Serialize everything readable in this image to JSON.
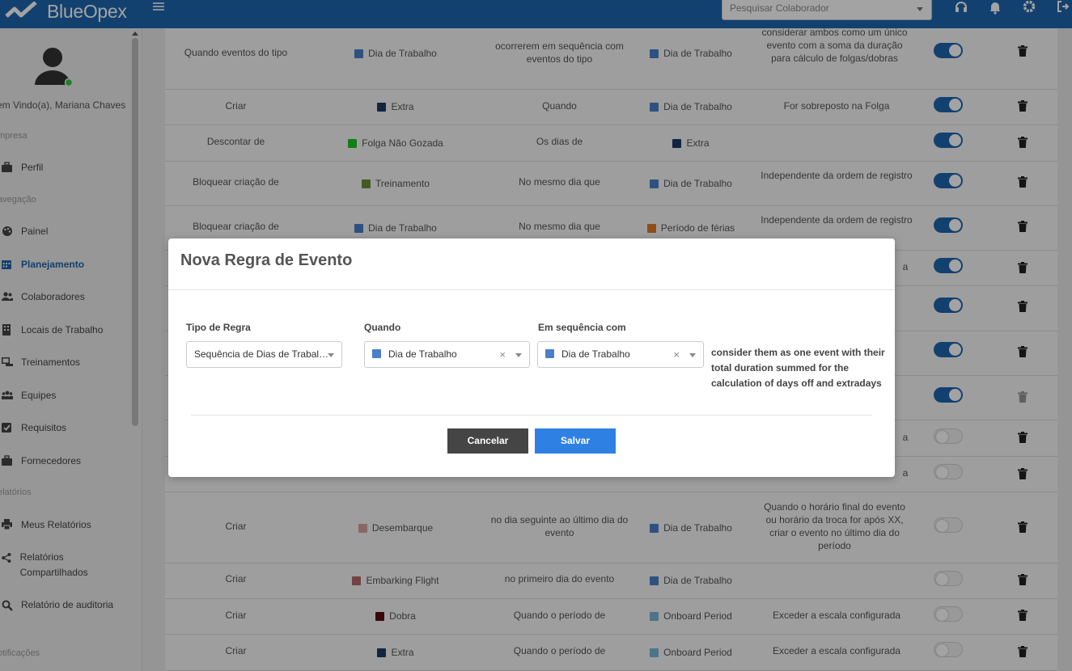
{
  "app": {
    "brand": "BlueOpex"
  },
  "topbar": {
    "search_placeholder": "Pesquisar Colaborador",
    "icons": [
      "headset-icon",
      "bell-icon",
      "gear-icon",
      "logout-icon"
    ]
  },
  "sidebar": {
    "welcome": "em Vindo(a), Mariana Chaves",
    "sections": {
      "empresa": "mpresa",
      "navegacao": "avegação",
      "relatorios": "elatórios",
      "notificacoes": "otificações"
    },
    "items": [
      {
        "label": "Perfil",
        "icon": "briefcase-icon"
      },
      {
        "label": "Painel",
        "icon": "palette-icon"
      },
      {
        "label": "Planejamento",
        "icon": "calendar-icon",
        "active": true
      },
      {
        "label": "Colaboradores",
        "icon": "users-icon"
      },
      {
        "label": "Locais de Trabalho",
        "icon": "building-icon"
      },
      {
        "label": "Treinamentos",
        "icon": "chalkboard-icon"
      },
      {
        "label": "Equipes",
        "icon": "team-icon"
      },
      {
        "label": "Requisitos",
        "icon": "checkbox-icon"
      },
      {
        "label": "Fornecedores",
        "icon": "briefcase-icon"
      },
      {
        "label": "Meus Relatórios",
        "icon": "printer-icon"
      },
      {
        "label": "Relatórios Compartilhados",
        "icon": "share-icon"
      },
      {
        "label": "Relatório de auditoria",
        "icon": "search-doc-icon"
      }
    ]
  },
  "colors": {
    "dia_de_trabalho": "#4a7fcb",
    "extra": "#1f3a66",
    "folga_nao_gozada": "#22c422",
    "treinamento": "#6b8e3a",
    "periodo_ferias": "#e07a22",
    "desembarque": "#d9a0a0",
    "embarking_flight": "#b56a6a",
    "dobra": "#5a0f0f",
    "onboard_period": "#7ab6d8"
  },
  "rules": [
    {
      "c1": "Quando eventos do tipo",
      "c2": {
        "label": "Dia de Trabalho",
        "color": "#4a7fcb"
      },
      "c3": "ocorrerem em sequência com eventos do tipo",
      "c4": {
        "label": "Dia de Trabalho",
        "color": "#4a7fcb"
      },
      "c5": "considerar ambos como um único evento com a soma da duração para cálculo de folgas/dobras",
      "enabled": true,
      "trash_disabled": false
    },
    {
      "c1": "Criar",
      "c2": {
        "label": "Extra",
        "color": "#1f3a66"
      },
      "c3": "Quando",
      "c4": {
        "label": "Dia de Trabalho",
        "color": "#4a7fcb"
      },
      "c5": "For sobreposto na Folga",
      "enabled": true,
      "trash_disabled": false
    },
    {
      "c1": "Descontar de",
      "c2": {
        "label": "Folga Não Gozada",
        "color": "#22c422"
      },
      "c3": "Os dias de",
      "c4": {
        "label": "Extra",
        "color": "#1f3a66"
      },
      "c5": "",
      "enabled": true,
      "trash_disabled": false
    },
    {
      "c1": "Bloquear criação de",
      "c2": {
        "label": "Treinamento",
        "color": "#6b8e3a"
      },
      "c3": "No mesmo dia que",
      "c4": {
        "label": "Dia de Trabalho",
        "color": "#4a7fcb"
      },
      "c5": "Independente da ordem de registro",
      "enabled": true,
      "trash_disabled": false
    },
    {
      "c1": "Bloquear criação de",
      "c2": {
        "label": "Dia de Trabalho",
        "color": "#4a7fcb"
      },
      "c3": "No mesmo dia que",
      "c4": {
        "label": "Período de férias",
        "color": "#e07a22"
      },
      "c5": "Independente da ordem de registro",
      "enabled": true,
      "trash_disabled": false
    },
    {
      "c1": "",
      "c2": {
        "label": "",
        "color": ""
      },
      "c3": "",
      "c4": {
        "label": "",
        "color": ""
      },
      "c5": "a",
      "enabled": true,
      "trash_disabled": false
    },
    {
      "c1": "",
      "c2": {
        "label": "",
        "color": ""
      },
      "c3": "",
      "c4": {
        "label": "",
        "color": ""
      },
      "c5": "",
      "enabled": true,
      "trash_disabled": false
    },
    {
      "c1": "",
      "c2": {
        "label": "",
        "color": ""
      },
      "c3": "",
      "c4": {
        "label": "",
        "color": ""
      },
      "c5": "",
      "enabled": true,
      "trash_disabled": false
    },
    {
      "c1": "",
      "c2": {
        "label": "",
        "color": ""
      },
      "c3": "",
      "c4": {
        "label": "",
        "color": ""
      },
      "c5": "",
      "enabled": true,
      "trash_disabled": true
    },
    {
      "c1": "",
      "c2": {
        "label": "",
        "color": ""
      },
      "c3": "",
      "c4": {
        "label": "",
        "color": ""
      },
      "c5": "a",
      "enabled": false,
      "trash_disabled": false
    },
    {
      "c1": "",
      "c2": {
        "label": "",
        "color": ""
      },
      "c3": "",
      "c4": {
        "label": "",
        "color": ""
      },
      "c5": "a",
      "enabled": false,
      "trash_disabled": false
    },
    {
      "c1": "Criar",
      "c2": {
        "label": "Desembarque",
        "color": "#d9a0a0"
      },
      "c3": "no dia seguinte ao último dia do evento",
      "c4": {
        "label": "Dia de Trabalho",
        "color": "#4a7fcb"
      },
      "c5": "Quando o horário final do evento ou horário da troca for após XX, criar o evento no último dia do período",
      "enabled": false,
      "trash_disabled": false
    },
    {
      "c1": "Criar",
      "c2": {
        "label": "Embarking Flight",
        "color": "#b56a6a"
      },
      "c3": "no primeiro dia do evento",
      "c4": {
        "label": "Dia de Trabalho",
        "color": "#4a7fcb"
      },
      "c5": "",
      "enabled": false,
      "trash_disabled": false
    },
    {
      "c1": "Criar",
      "c2": {
        "label": "Dobra",
        "color": "#5a0f0f"
      },
      "c3": "Quando o período de",
      "c4": {
        "label": "Onboard Period",
        "color": "#7ab6d8"
      },
      "c5": "Exceder a escala configurada",
      "enabled": false,
      "trash_disabled": false
    },
    {
      "c1": "Criar",
      "c2": {
        "label": "Extra",
        "color": "#1f3a66"
      },
      "c3": "Quando o período de",
      "c4": {
        "label": "Onboard Period",
        "color": "#7ab6d8"
      },
      "c5": "Exceder a escala configurada",
      "enabled": false,
      "trash_disabled": false
    }
  ],
  "modal": {
    "title": "Nova Regra de Evento",
    "fields": {
      "tipo_label": "Tipo de Regra",
      "tipo_value": "Sequência de Dias de Trabal…",
      "quando_label": "Quando",
      "quando_value": "Dia de Trabalho",
      "quando_color": "#4a7fcb",
      "sequencia_label": "Em sequência com",
      "sequencia_value": "Dia de Trabalho",
      "sequencia_color": "#4a7fcb"
    },
    "consider_text": "consider them as one event with their total duration summed for the calculation of days off and extradays",
    "cancel_label": "Cancelar",
    "save_label": "Salvar",
    "clear_glyph": "×"
  }
}
